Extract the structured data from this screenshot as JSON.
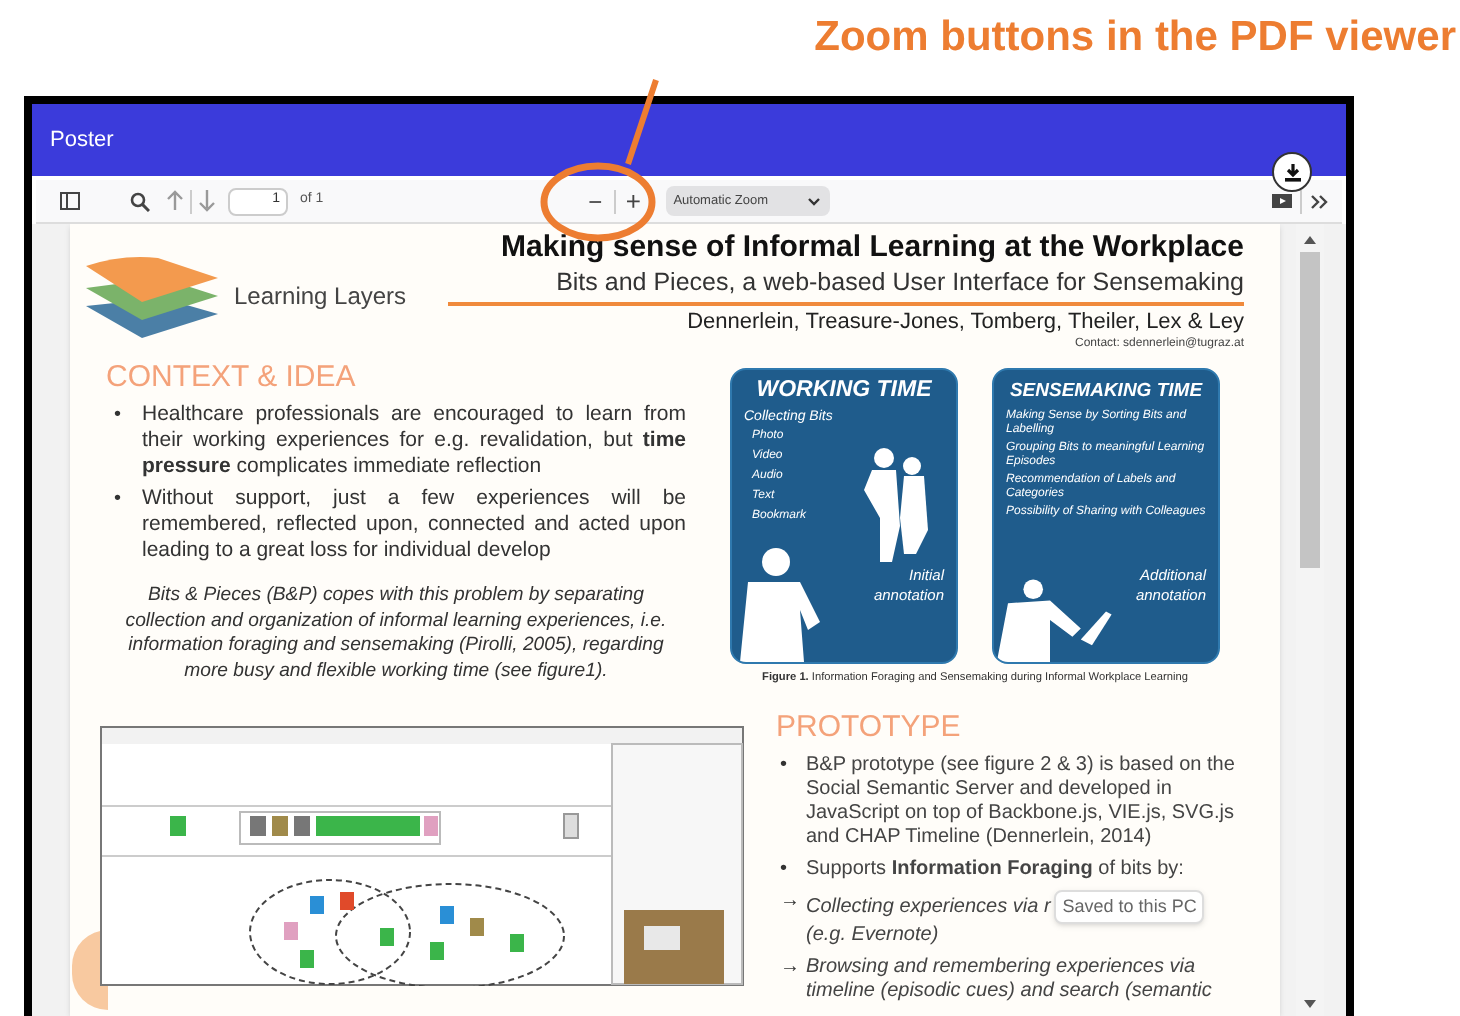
{
  "annotation": {
    "label": "Zoom buttons in the PDF viewer"
  },
  "window": {
    "title": "Poster"
  },
  "toolbar": {
    "page_number": "1",
    "page_count": "of 1",
    "zoom_out": "−",
    "zoom_in": "+",
    "zoom_select": "Automatic Zoom"
  },
  "poster": {
    "logo_text": "Learning Layers",
    "title": "Making sense of Informal Learning at the Workplace",
    "subtitle": "Bits and Pieces, a web-based User Interface for Sensemaking",
    "authors": "Dennerlein, Treasure-Jones, Tomberg, Theiler, Lex & Ley",
    "contact": "Contact: sdennerlein@tugraz.at",
    "context": {
      "heading": "CONTEXT & IDEA",
      "bullets": [
        {
          "marker": "•",
          "text": "Healthcare professionals are encouraged to learn from their working experiences for e.g. revalidation, but **time pressure** complicates immediate reflection"
        },
        {
          "marker": "•",
          "text": "Without support, just a few experiences will be remembered, reflected upon, connected and acted upon leading to a great loss for individual develop"
        }
      ],
      "summary": "Bits & Pieces (B&P) copes with this problem by separating collection and organization of informal learning experiences, i.e. information foraging and sensemaking (Pirolli, 2005), regarding more busy and flexible working time (see figure1)."
    },
    "figure1": {
      "cards": [
        {
          "kind": "working",
          "heading": "WORKING TIME",
          "subheading": "Collecting Bits",
          "items": [
            "Photo",
            "Video",
            "Audio",
            "Text",
            "Bookmark"
          ],
          "note": "Initial annotation"
        },
        {
          "kind": "sensemaking",
          "heading": "SENSEMAKING TIME",
          "items": [
            "Making Sense by Sorting Bits and Labelling",
            "Grouping Bits to meaningful Learning Episodes",
            "Recommendation of Labels and Categories",
            "Possibility of Sharing with Colleagues"
          ],
          "note": "Additional annotation"
        }
      ],
      "caption": "**Figure 1.** Information Foraging and Sensemaking during Informal Workplace Learning"
    },
    "prototype": {
      "heading": "PROTOTYPE",
      "bullets": [
        {
          "marker": "•",
          "kind": "plain",
          "text": "B&P prototype (see figure 2 & 3) is based on the Social Semantic Server and developed in JavaScript on top of Backbone.js, VIE.js, SVG.js and CHAP Timeline (Dennerlein, 2014)"
        },
        {
          "marker": "•",
          "kind": "plain",
          "text": "Supports **Information Foraging** of bits by:"
        },
        {
          "marker": "→",
          "kind": "italic",
          "text": "Collecting experiences via r",
          "tooltip": "Saved to this PC",
          "text_after": "(e.g. Evernote)"
        },
        {
          "marker": "→",
          "kind": "italic",
          "text": "Browsing and remembering experiences via timeline (episodic cues) and search (semantic"
        }
      ]
    }
  }
}
